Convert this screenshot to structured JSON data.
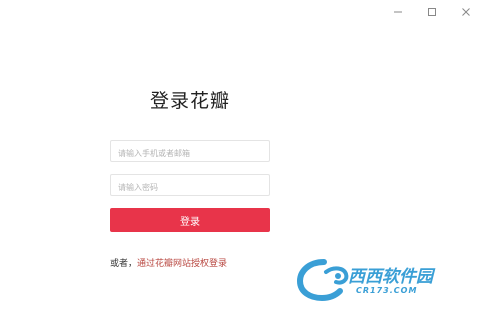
{
  "window": {
    "controls": [
      "minimize",
      "maximize",
      "close"
    ]
  },
  "login": {
    "title": "登录花瓣",
    "phone_placeholder": "请输入手机或者邮箱",
    "password_placeholder": "请输入密码",
    "submit_label": "登录",
    "alt_prefix": "或者，",
    "alt_link": "通过花瓣网站授权登录"
  },
  "watermark": {
    "name": "西西软件园",
    "site": "CR173.COM"
  },
  "colors": {
    "accent": "#e8344a",
    "link": "#b8463f",
    "watermark": "#3a9fd6"
  }
}
